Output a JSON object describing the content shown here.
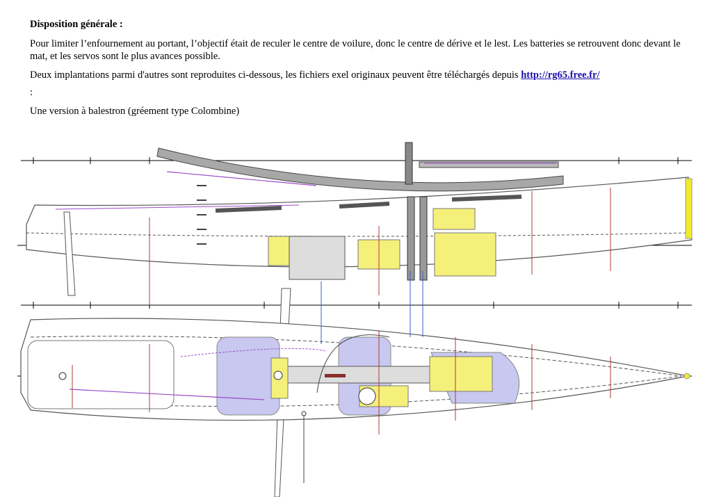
{
  "document": {
    "heading": "Disposition générale :",
    "paragraph1": "Pour limiter l’enfournement au portant, l’objectif était de reculer le centre de voilure, donc le centre de dérive et le lest. Les batteries se retrouvent donc devant le mat, et les servos sont le plus avances possible.",
    "paragraph2_text": "Deux implantations parmi d'autres sont reproduites ci-dessous, les fichiers exel originaux peuvent être téléchargés depuis ",
    "paragraph2_link": "http://rg65.free.fr/",
    "colon_line": ":",
    "caption": "Une version à balestron (gréement type Colombine)"
  },
  "drawing": {
    "icon": "boat-layout-drawing",
    "colors": {
      "hull": "#555555",
      "frames": "#b03a3a",
      "battery_yellow": "#f5f07a",
      "servo_blue": "#c9c8f0",
      "rigging_purple": "#9a4ac8",
      "boom_grey": "#a8a8a8"
    }
  }
}
